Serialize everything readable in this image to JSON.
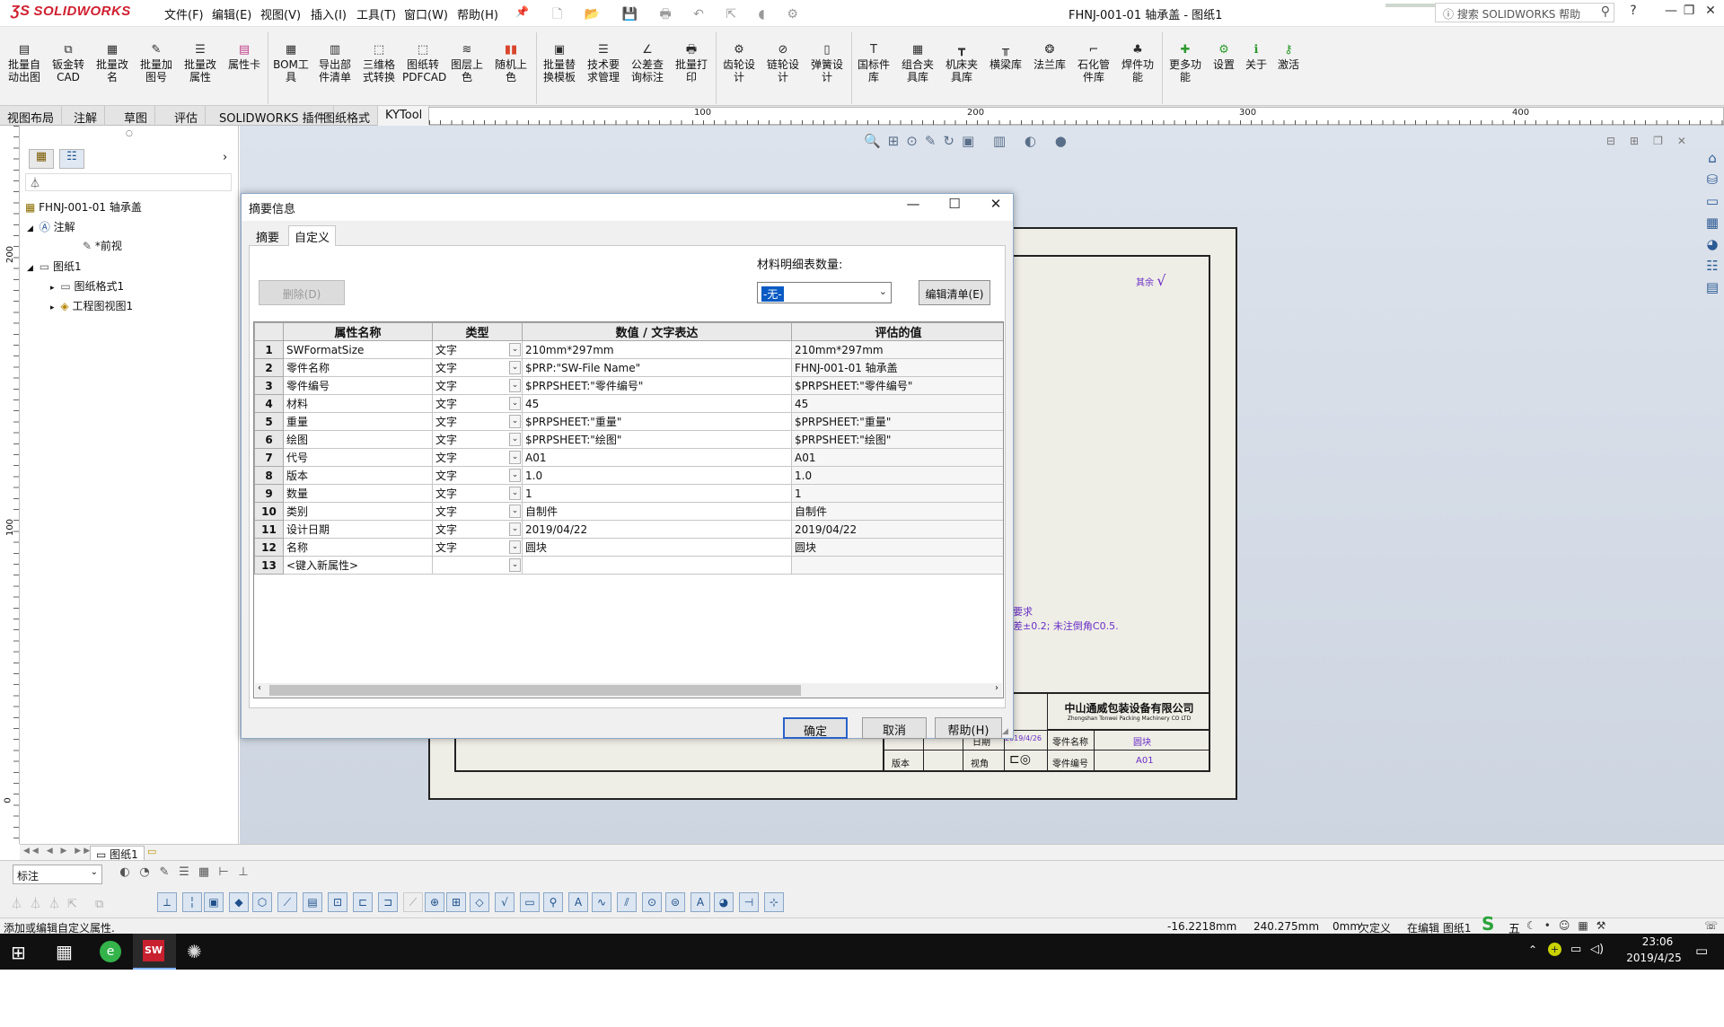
{
  "app": {
    "logo": "SOLIDWORKS",
    "menu": [
      "文件(F)",
      "编辑(E)",
      "视图(V)",
      "插入(I)",
      "工具(T)",
      "窗口(W)",
      "帮助(H)"
    ],
    "doc_title": "FHNJ-001-01 轴承盖 - 图纸1",
    "search_placeholder": "搜索 SOLIDWORKS 帮助",
    "window_controls": [
      "?",
      "—",
      "❐",
      "✕"
    ]
  },
  "toolbar": {
    "tools": [
      "批量自动出图",
      "钣金转CAD",
      "批量改名",
      "批量加图号",
      "批量改属性",
      "属性卡",
      "BOM工具",
      "导出部件清单",
      "三维格式转换",
      "图纸转PDFCAD",
      "图层上色",
      "随机上色",
      "批量替换模板",
      "技术要求管理",
      "公差查询标注",
      "批量打印",
      "齿轮设计",
      "链轮设计",
      "弹簧设计",
      "国标件库",
      "组合夹具库",
      "机床夹具库",
      "横梁库",
      "法兰库",
      "石化管件库",
      "焊件功能",
      "更多功能",
      "设置",
      "关于",
      "激活"
    ]
  },
  "command_tabs": [
    "视图布局",
    "注解",
    "草图",
    "评估",
    "SOLIDWORKS 插件",
    "图纸格式",
    "KYTool"
  ],
  "ruler": {
    "marks": [
      "100",
      "200",
      "300",
      "400"
    ]
  },
  "vruler": {
    "marks": [
      "200",
      "100",
      "0"
    ]
  },
  "feature_tree": {
    "root": "FHNJ-001-01 轴承盖",
    "items": [
      "注解",
      "*前视",
      "图纸1",
      "图纸格式1",
      "工程图视图1"
    ]
  },
  "dialog": {
    "title": "摘要信息",
    "tabs": [
      "摘要",
      "自定义"
    ],
    "delete_button": "删除(D)",
    "bom_label": "材料明细表数量:",
    "bom_value": "-无-",
    "edit_list_button": "编辑清单(E)",
    "columns": [
      "属性名称",
      "类型",
      "数值 / 文字表达",
      "评估的值"
    ],
    "rows": [
      {
        "n": "1",
        "name": "SWFormatSize",
        "type": "文字",
        "value": "210mm*297mm",
        "eval": "210mm*297mm"
      },
      {
        "n": "2",
        "name": "零件名称",
        "type": "文字",
        "value": "$PRP:\"SW-File Name\"",
        "eval": "FHNJ-001-01 轴承盖"
      },
      {
        "n": "3",
        "name": "零件编号",
        "type": "文字",
        "value": "$PRPSHEET:\"零件编号\"",
        "eval": "$PRPSHEET:\"零件编号\""
      },
      {
        "n": "4",
        "name": "材料",
        "type": "文字",
        "value": "45",
        "eval": "45"
      },
      {
        "n": "5",
        "name": "重量",
        "type": "文字",
        "value": "$PRPSHEET:\"重量\"",
        "eval": "$PRPSHEET:\"重量\""
      },
      {
        "n": "6",
        "name": "绘图",
        "type": "文字",
        "value": "$PRPSHEET:\"绘图\"",
        "eval": "$PRPSHEET:\"绘图\""
      },
      {
        "n": "7",
        "name": "代号",
        "type": "文字",
        "value": "A01",
        "eval": "A01"
      },
      {
        "n": "8",
        "name": "版本",
        "type": "文字",
        "value": "1.0",
        "eval": "1.0"
      },
      {
        "n": "9",
        "name": "数量",
        "type": "文字",
        "value": "1",
        "eval": "1"
      },
      {
        "n": "10",
        "name": "类别",
        "type": "文字",
        "value": "自制件",
        "eval": "自制件"
      },
      {
        "n": "11",
        "name": "设计日期",
        "type": "文字",
        "value": "2019/04/22",
        "eval": "2019/04/22"
      },
      {
        "n": "12",
        "name": "名称",
        "type": "文字",
        "value": "圆块",
        "eval": "圆块"
      },
      {
        "n": "13",
        "name": "<键入新属性>",
        "type": "",
        "value": "",
        "eval": ""
      }
    ],
    "ok": "确定",
    "cancel": "取消",
    "help": "帮助(H)"
  },
  "drawing": {
    "company": "中山通威包装设备有限公司",
    "company_en": "Zhongshan Tonwei Packing Machinery CO LTD",
    "note1": "要求",
    "note2": "差±0.2; 未注倒角C0.5.",
    "tb_labels": [
      "日期",
      "零件名称",
      "版本",
      "视角",
      "零件编号"
    ],
    "tb_values": [
      "2019/4/26",
      "圆块",
      "A01"
    ],
    "roughness": "其余"
  },
  "bottom": {
    "sheet_tab": "图纸1",
    "layer_select": "标注",
    "status_left": "添加或编辑自定义属性.",
    "coord_x": "-16.2218mm",
    "coord_y": "240.275mm",
    "coord_z": "0mm",
    "defined": "欠定义",
    "editing": "在编辑 图纸1",
    "ime": "五"
  },
  "taskbar": {
    "time": "23:06",
    "date": "2019/4/25"
  }
}
